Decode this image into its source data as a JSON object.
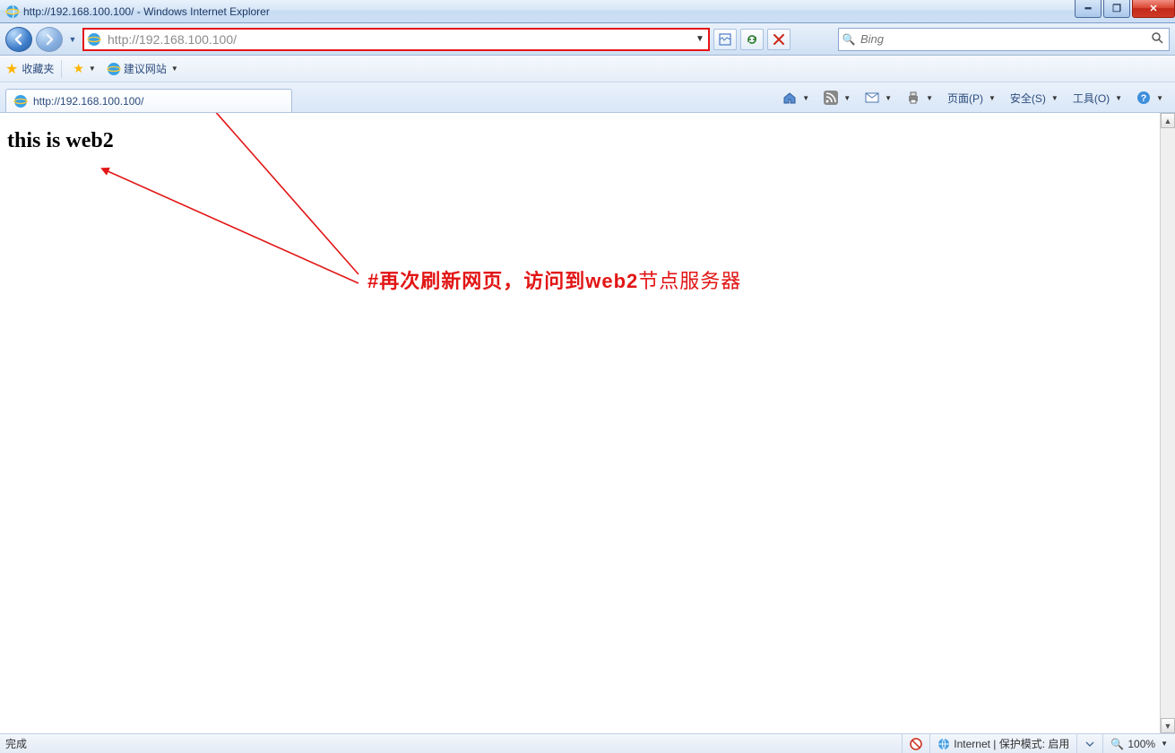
{
  "window": {
    "title": "http://192.168.100.100/ - Windows Internet Explorer"
  },
  "nav": {
    "url": "http://192.168.100.100/",
    "search_placeholder": "Bing"
  },
  "favbar": {
    "label": "收藏夹",
    "suggested": "建议网站"
  },
  "tab": {
    "title": "http://192.168.100.100/"
  },
  "cmd": {
    "page": "页面(P)",
    "safety": "安全(S)",
    "tools": "工具(O)"
  },
  "page": {
    "heading": "this is web2"
  },
  "annotation": {
    "text_prefix": "#再次刷新网页，访问到",
    "text_bold": "web2",
    "text_suffix": "节点服务器"
  },
  "status": {
    "done": "完成",
    "zone": "Internet | 保护模式: 启用",
    "zoom": "100%"
  }
}
